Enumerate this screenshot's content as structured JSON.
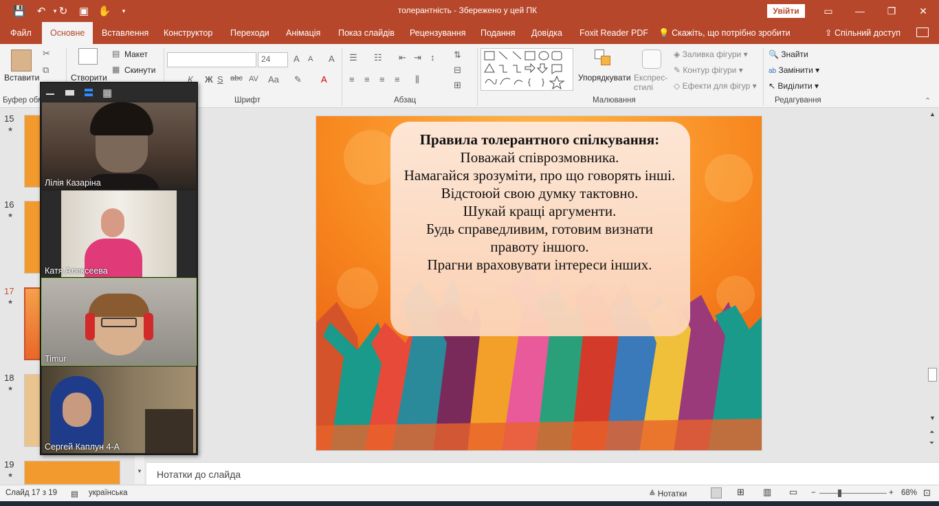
{
  "window": {
    "title": "толерантність  -  Збережено у цей ПК",
    "signin_label": "Увійти"
  },
  "tabs": [
    "Файл",
    "Основне",
    "Вставлення",
    "Конструктор",
    "Переходи",
    "Анімація",
    "Показ слайдів",
    "Рецензування",
    "Подання",
    "Довідка",
    "Foxit Reader PDF"
  ],
  "tell_me": "Скажіть, що потрібно зробити",
  "share": "Спільний доступ",
  "ribbon": {
    "paste_label": "Вставити",
    "clipboard_group": "Буфер обм",
    "new_slide_label": "Створити",
    "layout_label": "Макет",
    "reset_label": "Скинути",
    "font_size": "24",
    "font_group": "Шрифт",
    "paragraph_group": "Абзац",
    "arrange_label": "Упорядкувати",
    "quick_styles_label": "Експрес-стилі",
    "shape_fill_label": "Заливка фігури",
    "shape_outline_label": "Контур фігури",
    "shape_effects_label": "Ефекти для фігур",
    "drawing_group": "Малювання",
    "find_label": "Знайти",
    "replace_label": "Замінити",
    "select_label": "Виділити",
    "editing_group": "Редагування"
  },
  "thumbnails": [
    {
      "number": "15"
    },
    {
      "number": "16"
    },
    {
      "number": "17",
      "selected": true
    },
    {
      "number": "18"
    },
    {
      "number": "19"
    }
  ],
  "slide": {
    "title": "Правила толерантного спілкування:",
    "lines": [
      "Поважай співрозмовника.",
      "Намагайся зрозуміти, про що говорять інші.",
      "Відстоюй свою думку тактовно.",
      "Шукай кращі аргументи.",
      "Будь справедливим, готовим визнати",
      "правоту іншого.",
      "Прагни враховувати інтереси інших."
    ]
  },
  "notes_placeholder": "Нотатки до слайда",
  "status": {
    "slide_counter": "Слайд 17 з 19",
    "language": "українська",
    "notes_button": "Нотатки",
    "zoom_percent": "68%"
  },
  "video_call": {
    "participants": [
      "Лілія Казаріна",
      "Катя Алексеева",
      "Timur",
      "Сергей Каплун 4-А"
    ]
  }
}
